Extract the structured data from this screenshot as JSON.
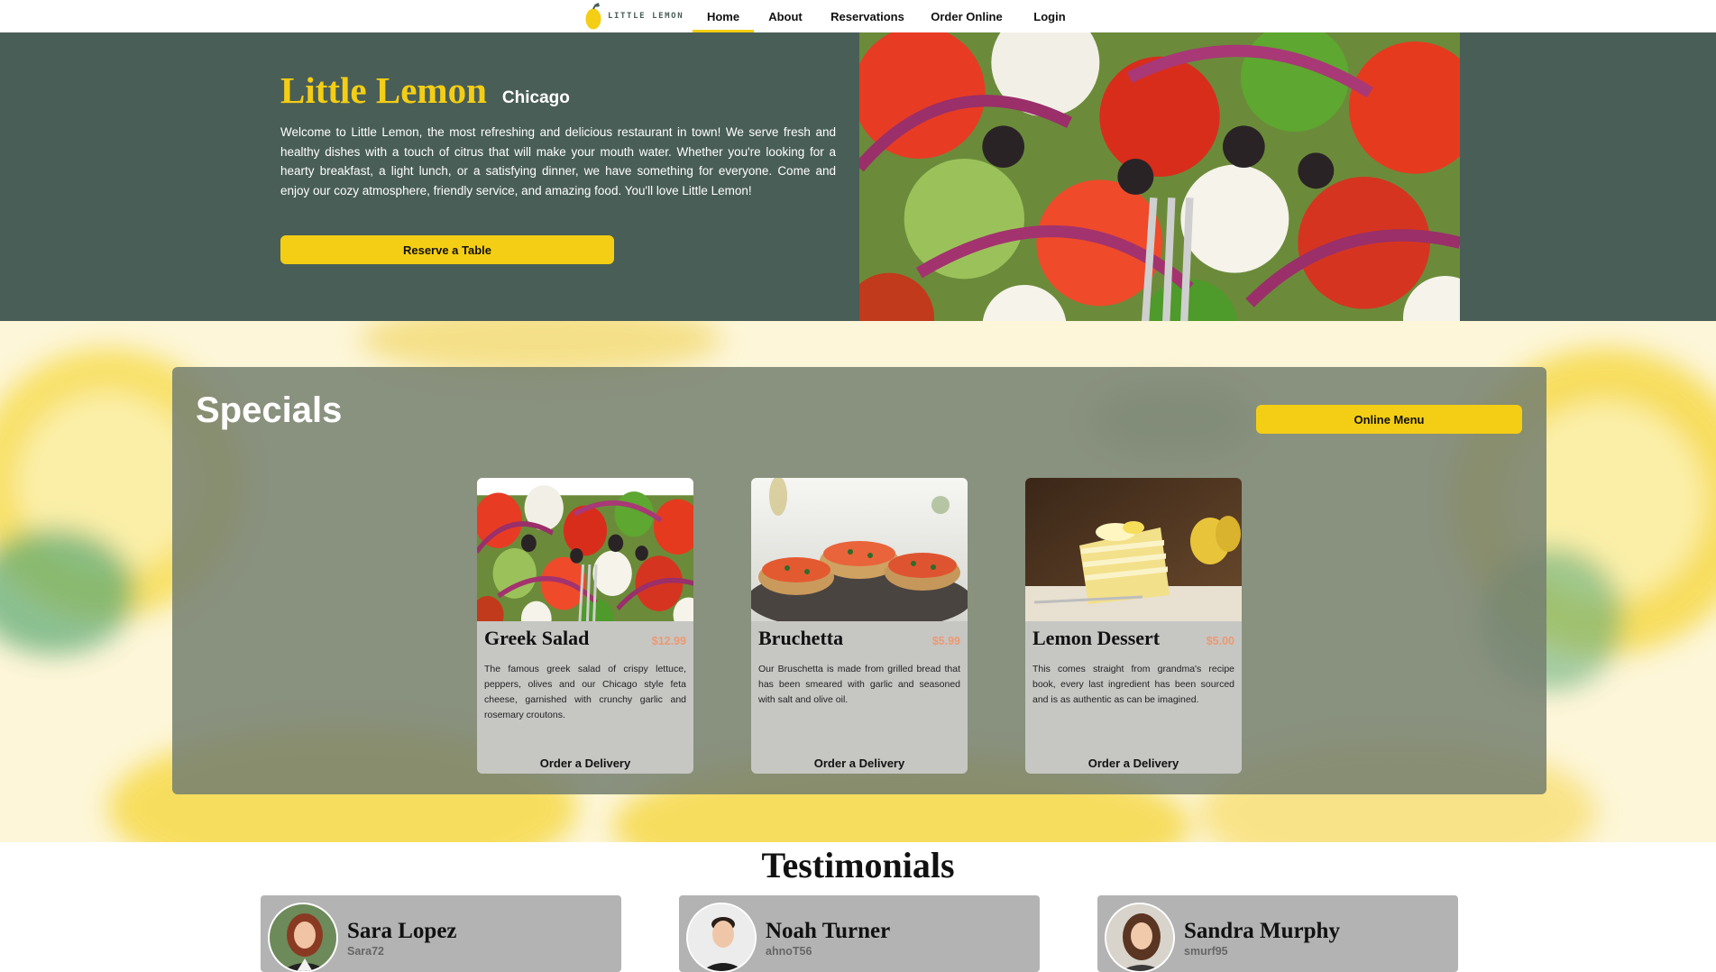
{
  "nav": {
    "logo_text": "LITTLE LEMON",
    "links": [
      "Home",
      "About",
      "Reservations",
      "Order Online",
      "Login"
    ],
    "active": "Home"
  },
  "hero": {
    "title": "Little Lemon",
    "city": "Chicago",
    "description": "Welcome to Little Lemon, the most refreshing and delicious restaurant in town! We serve fresh and healthy dishes with a touch of citrus that will make your mouth water. Whether you're looking for a hearty breakfast, a light lunch, or a satisfying dinner, we have something for everyone. Come and enjoy our cozy atmosphere, friendly service, and amazing food. You'll love Little Lemon!",
    "button": "Reserve a Table",
    "image": "greek-salad-photo"
  },
  "specials": {
    "title": "Specials",
    "menu_button": "Online Menu",
    "cards": [
      {
        "name": "Greek Salad",
        "price": "$12.99",
        "description": "The famous greek salad of crispy lettuce, peppers, olives and our Chicago style feta cheese, garnished with crunchy garlic and rosemary croutons.",
        "action": "Order a Delivery",
        "image": "greek-salad-photo"
      },
      {
        "name": "Bruchetta",
        "price": "$5.99",
        "description": "Our Bruschetta is made from grilled bread that has been smeared with garlic and seasoned with salt and olive oil.",
        "action": "Order a Delivery",
        "image": "bruschetta-photo"
      },
      {
        "name": "Lemon Dessert",
        "price": "$5.00",
        "description": "This comes straight from grandma's recipe book, every last ingredient has been sourced and is as authentic as can be imagined.",
        "action": "Order a Delivery",
        "image": "lemon-cake-photo"
      }
    ]
  },
  "testimonials": {
    "title": "Testimonials",
    "items": [
      {
        "name": "Sara Lopez",
        "username": "Sara72"
      },
      {
        "name": "Noah Turner",
        "username": "ahnoT56"
      },
      {
        "name": "Sandra Murphy",
        "username": "smurf95"
      }
    ]
  },
  "colors": {
    "primary_green": "#495e57",
    "primary_yellow": "#f4ce14",
    "price_orange": "#ee9972",
    "card_gray": "#c6c6c3",
    "testimonial_gray": "#b3b3b3"
  }
}
